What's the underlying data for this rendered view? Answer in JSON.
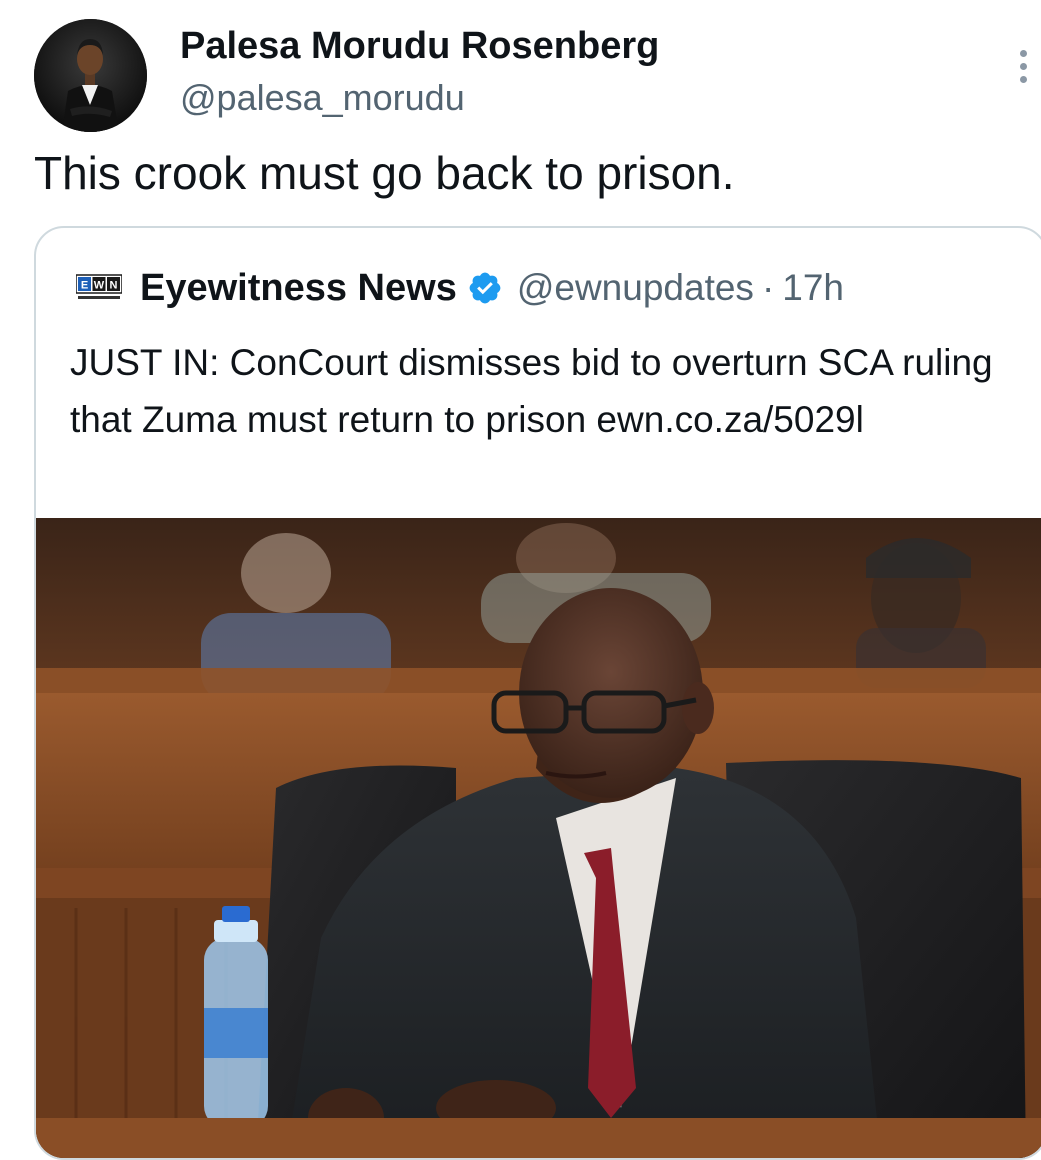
{
  "author": {
    "display_name": "Palesa Morudu Rosenberg",
    "handle": "@palesa_morudu",
    "avatar_icon": "profile-photo"
  },
  "tweet": {
    "text": "This crook must go back to prison."
  },
  "more_icon": "more-vertical-icon",
  "quote": {
    "source_logo": "ewn-logo",
    "name": "Eyewitness News",
    "verified_icon": "verified-badge-icon",
    "verified_color": "#1d9bf0",
    "handle": "@ewnupdates",
    "separator": "·",
    "time": "17h",
    "text": "JUST IN: ConCourt dismisses bid to overturn SCA ruling that Zuma must return to prison ewn.co.za/5029l",
    "photo_icon": "courtroom-photo"
  },
  "colors": {
    "text_primary": "#0f1419",
    "text_secondary": "#536471",
    "border": "#cfd9de"
  }
}
